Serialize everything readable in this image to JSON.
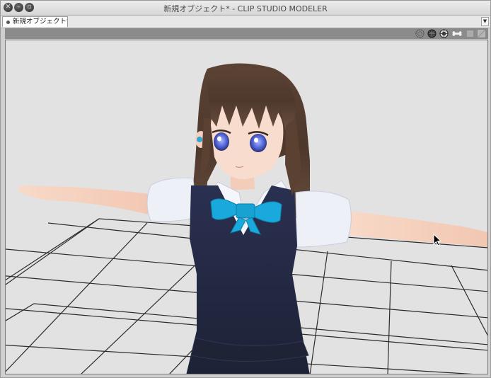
{
  "window": {
    "title": "新規オブジェクト* - CLIP STUDIO MODELER"
  },
  "traffic_lights": [
    "close-icon",
    "minimize-icon",
    "maximize-icon"
  ],
  "tabs": [
    {
      "label": "新規オブジェクト*",
      "active": true
    }
  ],
  "toolbar": {
    "icons": [
      "wireframe-sphere-icon",
      "solid-sphere-icon",
      "shaded-sphere-icon",
      "bone-icon",
      "light-icon",
      "camera-icon"
    ]
  },
  "viewport": {
    "background": "#e2e2e2",
    "grid": true,
    "model": "3D anime girl character in T-pose"
  },
  "colors": {
    "hair": "#5a3f30",
    "skin": "#f6d2bf",
    "vest": "#262c45",
    "shirt": "#f3f4fb",
    "ribbon": "#19a8d8",
    "eyes": "#5a6fd6"
  }
}
